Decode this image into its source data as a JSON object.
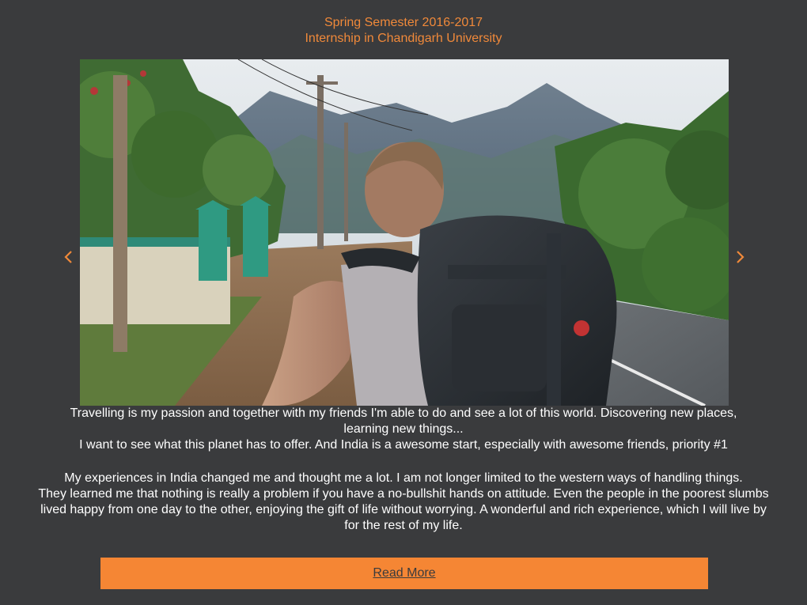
{
  "header": {
    "line1": "Spring Semester 2016-2017",
    "line2": "Internship in Chandigarh University"
  },
  "carousel": {
    "image": "photo of a backpacker on a rural road with mountains in the background",
    "prev_icon": "chevron-left-icon",
    "next_icon": "chevron-right-icon",
    "accent_color": "#f0893a"
  },
  "text": {
    "para1_line1": "Travelling is my passion and together with my friends I'm able to do and see a lot of this world. Discovering new places,",
    "para1_line2": "learning new things...",
    "para1_line3": "I want to see what this planet has to offer. And India is a awesome start, especially with awesome friends, priority #1",
    "para2_line1": "My experiences in India changed me and thought me a lot. I am not longer limited to the western ways of handling things.",
    "para2_line2": "They learned me that nothing is really a problem if you have a no-bullshit hands on attitude. Even the people in the poorest slumbs",
    "para2_line3": "lived happy from one day to the other, enjoying the gift of life without worrying. A wonderful and rich experience, which I will live by",
    "para2_line4": "for the rest of my life."
  },
  "button": {
    "label": "Read More",
    "color": "#f58634"
  }
}
